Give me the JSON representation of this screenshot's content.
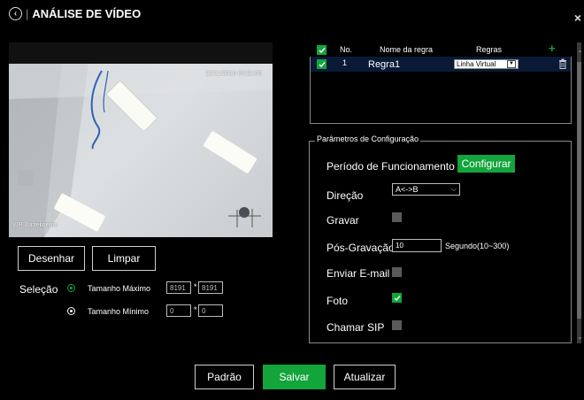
{
  "header": {
    "title": "ANÁLISE DE VÍDEO",
    "close_glyph": "×",
    "back_glyph": "‹"
  },
  "video": {
    "timestamp": "22/11/2016 09:21:09",
    "caption": "VIP 1 Inteligente"
  },
  "draw_buttons": {
    "draw": "Desenhar",
    "clear": "Limpar"
  },
  "selection": {
    "label": "Seleção",
    "max_label": "Tamanho Máximo",
    "max_w": "8191",
    "max_h": "8191",
    "min_label": "Tamanho Mínimo",
    "min_w": "0",
    "min_h": "0",
    "separator": "*"
  },
  "rules": {
    "headers": {
      "no": "No.",
      "name": "Nome da regra",
      "rules": "Regras"
    },
    "add_glyph": "+",
    "rows": [
      {
        "no": "1",
        "name": "Regra1",
        "type": "Linha Virtual"
      }
    ]
  },
  "config": {
    "legend": "Parâmetros de Configuração",
    "period_label": "Período de Funcionamento",
    "configure_button": "Configurar",
    "direction_label": "Direção",
    "direction_value": "A<->B",
    "record_label": "Gravar",
    "post_record_label": "Pós-Gravação",
    "post_record_value": "10",
    "post_record_unit": "Segundo(10~300)",
    "email_label": "Enviar E-mail",
    "photo_label": "Foto",
    "sip_label": "Chamar SIP",
    "record_checked": false,
    "email_checked": false,
    "photo_checked": true,
    "sip_checked": false
  },
  "footer": {
    "default": "Padrão",
    "save": "Salvar",
    "refresh": "Atualizar"
  },
  "colors": {
    "accent": "#13a43b",
    "background": "#000000",
    "selected_row": "#0a1a36"
  },
  "icons": [
    "back-circle-icon",
    "close-icon",
    "add-icon",
    "trash-icon",
    "chevron-down-icon",
    "check-icon"
  ]
}
